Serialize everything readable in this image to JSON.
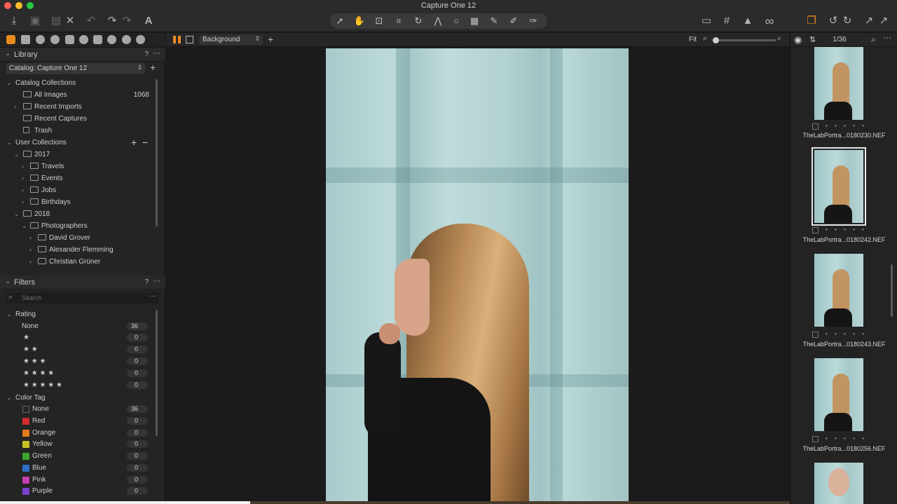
{
  "window": {
    "title": "Capture One 12"
  },
  "toolbar": {
    "left": [
      {
        "icon": "import-icon",
        "glyph": "⤓"
      },
      {
        "icon": "camera-icon",
        "glyph": "▣"
      },
      {
        "icon": "tethered-camera-icon",
        "glyph": "▤"
      },
      {
        "icon": "delete-icon",
        "glyph": "✕"
      },
      {
        "icon": "undo-icon",
        "glyph": "↶"
      },
      {
        "icon": "redo-icon",
        "glyph": "↷"
      },
      {
        "icon": "text-tool-icon",
        "glyph": "A"
      }
    ],
    "cursor_tools": [
      {
        "icon": "select-cursor-icon",
        "glyph": "➚"
      },
      {
        "icon": "pan-hand-icon",
        "glyph": "✋"
      },
      {
        "icon": "loupe-icon",
        "glyph": "⊡"
      },
      {
        "icon": "crop-icon",
        "glyph": "⌗"
      },
      {
        "icon": "rotate-icon",
        "glyph": "↻"
      },
      {
        "icon": "keystone-icon",
        "glyph": "⋀"
      },
      {
        "icon": "spot-removal-icon",
        "glyph": "○"
      },
      {
        "icon": "annotate-icon",
        "glyph": "▦"
      },
      {
        "icon": "brush-icon",
        "glyph": "✎"
      },
      {
        "icon": "erase-icon",
        "glyph": "✐"
      },
      {
        "icon": "pick-color-icon",
        "glyph": "✑"
      }
    ],
    "right": [
      {
        "icon": "proof-icon",
        "glyph": "▭"
      },
      {
        "icon": "grid-icon",
        "glyph": "#"
      },
      {
        "icon": "exposure-warning-icon",
        "glyph": "▲"
      },
      {
        "icon": "glasses-icon",
        "glyph": "∞"
      },
      {
        "icon": "copy-adjustments-icon",
        "glyph": "❐"
      },
      {
        "icon": "reset-icon",
        "glyph": "↺"
      },
      {
        "icon": "redo-adjust-icon",
        "glyph": "↻"
      },
      {
        "icon": "apply-icon",
        "glyph": "↗"
      }
    ]
  },
  "library": {
    "title": "Library",
    "help": "?",
    "more": "···",
    "catalog": "Catalog: Capture One 12",
    "catalog_collections": "Catalog Collections",
    "items": [
      {
        "label": "All Images",
        "count": "1068"
      },
      {
        "label": "Recent Imports",
        "count": ""
      },
      {
        "label": "Recent Captures",
        "count": ""
      },
      {
        "label": "Trash",
        "count": ""
      }
    ],
    "user_collections": "User Collections",
    "tree": [
      {
        "label": "2017",
        "level": 1
      },
      {
        "label": "Travels",
        "level": 2
      },
      {
        "label": "Events",
        "level": 2
      },
      {
        "label": "Jobs",
        "level": 2
      },
      {
        "label": "Birthdays",
        "level": 2
      },
      {
        "label": "2018",
        "level": 1
      },
      {
        "label": "Photographers",
        "level": 2
      },
      {
        "label": "David Grover",
        "level": 3
      },
      {
        "label": "Alexander Flemming",
        "level": 3
      },
      {
        "label": "Christian Grüner",
        "level": 3
      }
    ]
  },
  "filters": {
    "title": "Filters",
    "help": "?",
    "more": "···",
    "search_placeholder": "Search",
    "rating_title": "Rating",
    "ratings": [
      {
        "label": "None",
        "count": "36"
      },
      {
        "label": "★",
        "count": "0"
      },
      {
        "label": "★ ★",
        "count": "0"
      },
      {
        "label": "★ ★ ★",
        "count": "0"
      },
      {
        "label": "★ ★ ★ ★",
        "count": "0"
      },
      {
        "label": "★ ★ ★ ★ ★",
        "count": "0"
      }
    ],
    "color_title": "Color Tag",
    "colors": [
      {
        "label": "None",
        "count": "36",
        "color": "#2a2a2a"
      },
      {
        "label": "Red",
        "count": "0",
        "color": "#d22b2b"
      },
      {
        "label": "Orange",
        "count": "0",
        "color": "#e07a1c"
      },
      {
        "label": "Yellow",
        "count": "0",
        "color": "#c8c226"
      },
      {
        "label": "Green",
        "count": "0",
        "color": "#3ba52d"
      },
      {
        "label": "Blue",
        "count": "0",
        "color": "#2f6ec6"
      },
      {
        "label": "Pink",
        "count": "0",
        "color": "#c33fae"
      },
      {
        "label": "Purple",
        "count": "0",
        "color": "#7a3fd0"
      }
    ]
  },
  "viewer": {
    "layer": "Background",
    "zoom_label": "Fit"
  },
  "browser": {
    "counter": "1/36",
    "thumbnails": [
      {
        "name": "TheLabPortra...0180230.NEF",
        "selected": false
      },
      {
        "name": "TheLabPortra...0180242.NEF",
        "selected": true
      },
      {
        "name": "TheLabPortra...0180243.NEF",
        "selected": false
      },
      {
        "name": "TheLabPortra...0180256.NEF",
        "selected": false
      }
    ],
    "dots": "• • • • •"
  },
  "colors": {
    "accent": "#e98a1f",
    "panel": "#242424",
    "background": "#1b1b1b"
  }
}
